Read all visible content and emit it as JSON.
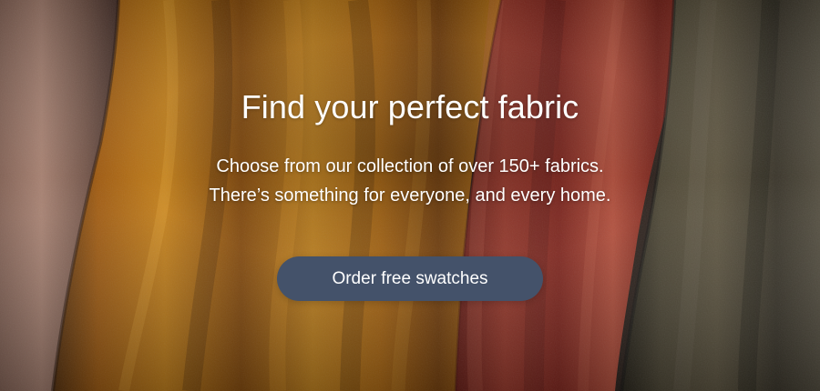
{
  "hero": {
    "headline": "Find your perfect fabric",
    "subtext_line1": "Choose from our collection of over 150+ fabrics.",
    "subtext_line2": "There’s something for everyone, and every home.",
    "cta_label": "Order free swatches",
    "background_image": "draped velvet fabric panels in mauve, golden ochre, rust red and olive green"
  },
  "colors": {
    "button_background": "#44526a",
    "text": "#ffffff",
    "mauve_fabric": "#9a7362",
    "ochre_fabric": "#c47d10",
    "rust_fabric": "#9b3024",
    "olive_fabric": "#4f4a37"
  }
}
